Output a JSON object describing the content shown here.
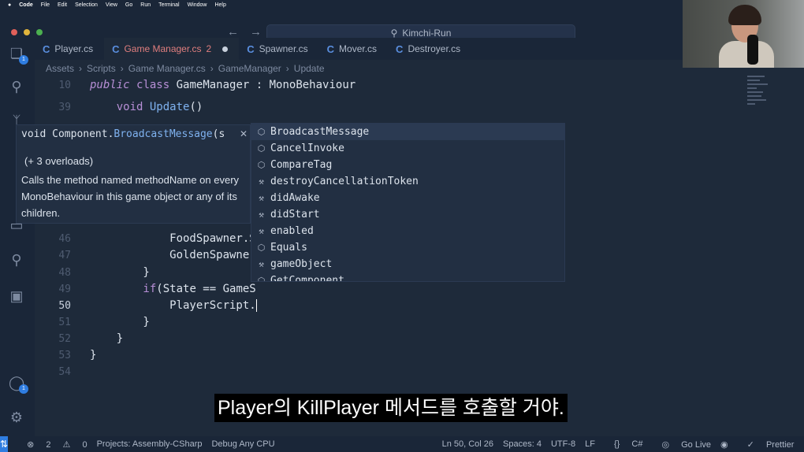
{
  "menubar": {
    "app": "Code",
    "items": [
      "File",
      "Edit",
      "Selection",
      "View",
      "Go",
      "Run",
      "Terminal",
      "Window",
      "Help"
    ]
  },
  "search": {
    "text": "Kimchi-Run"
  },
  "activity_badges": {
    "explorer": "1",
    "account": "1"
  },
  "tabs": [
    {
      "label": "Player.cs"
    },
    {
      "label": "Game Manager.cs",
      "problems": "2"
    },
    {
      "label": "Spawner.cs"
    },
    {
      "label": "Mover.cs"
    },
    {
      "label": "Destroyer.cs"
    }
  ],
  "breadcrumb": [
    "Assets",
    "Scripts",
    "Game Manager.cs",
    "GameManager",
    "Update"
  ],
  "code_lines": [
    {
      "n": "10",
      "parts": [
        [
          "kw",
          "public"
        ],
        [
          "plain",
          " "
        ],
        [
          "kw2",
          "class"
        ],
        [
          "plain",
          " GameManager : MonoBehaviour"
        ]
      ]
    },
    {
      "n": "39",
      "parts": [
        [
          "plain",
          "    "
        ],
        [
          "kw2",
          "void"
        ],
        [
          "plain",
          " "
        ],
        [
          "fn",
          "Update"
        ],
        [
          "plain",
          "()"
        ]
      ]
    },
    {
      "n": "46",
      "parts": [
        [
          "plain",
          "            FoodSpawner.S"
        ]
      ]
    },
    {
      "n": "47",
      "parts": [
        [
          "plain",
          "            GoldenSpawner"
        ]
      ]
    },
    {
      "n": "48",
      "parts": [
        [
          "plain",
          "        }"
        ]
      ]
    },
    {
      "n": "49",
      "parts": [
        [
          "kw2",
          "        if"
        ],
        [
          "plain",
          "(State == GameS"
        ]
      ]
    },
    {
      "n": "50",
      "parts": [
        [
          "plain",
          "            PlayerScript."
        ]
      ]
    },
    {
      "n": "51",
      "parts": [
        [
          "plain",
          "        }"
        ]
      ]
    },
    {
      "n": "52",
      "parts": [
        [
          "plain",
          "    }"
        ]
      ]
    },
    {
      "n": "53",
      "parts": [
        [
          "plain",
          "}"
        ]
      ]
    },
    {
      "n": "54",
      "parts": [
        [
          "plain",
          ""
        ]
      ]
    }
  ],
  "hover": {
    "sig_prefix": "void Component.",
    "sig_method": "BroadcastMessage",
    "sig_suffix": "(s",
    "overloads": "(+ 3 overloads)",
    "description": "Calls the method named methodName on every MonoBehaviour in this game object or any of its children."
  },
  "suggestions": [
    {
      "label": "BroadcastMessage",
      "kind": "method"
    },
    {
      "label": "CancelInvoke",
      "kind": "method"
    },
    {
      "label": "CompareTag",
      "kind": "method"
    },
    {
      "label": "destroyCancellationToken",
      "kind": "property"
    },
    {
      "label": "didAwake",
      "kind": "property"
    },
    {
      "label": "didStart",
      "kind": "property"
    },
    {
      "label": "enabled",
      "kind": "property"
    },
    {
      "label": "Equals",
      "kind": "method"
    },
    {
      "label": "gameObject",
      "kind": "property"
    },
    {
      "label": "GetComponent",
      "kind": "method"
    }
  ],
  "subtitle": "Player의 KillPlayer 메서드를 호출할 거야.",
  "status": {
    "errors": "2",
    "warnings": "0",
    "project": "Projects: Assembly-CSharp",
    "debug": "Debug Any CPU",
    "position": "Ln 50, Col 26",
    "spaces": "Spaces: 4",
    "encoding": "UTF-8",
    "eol": "LF",
    "language": "C#",
    "golive": "Go Live",
    "prettier": "Prettier"
  }
}
